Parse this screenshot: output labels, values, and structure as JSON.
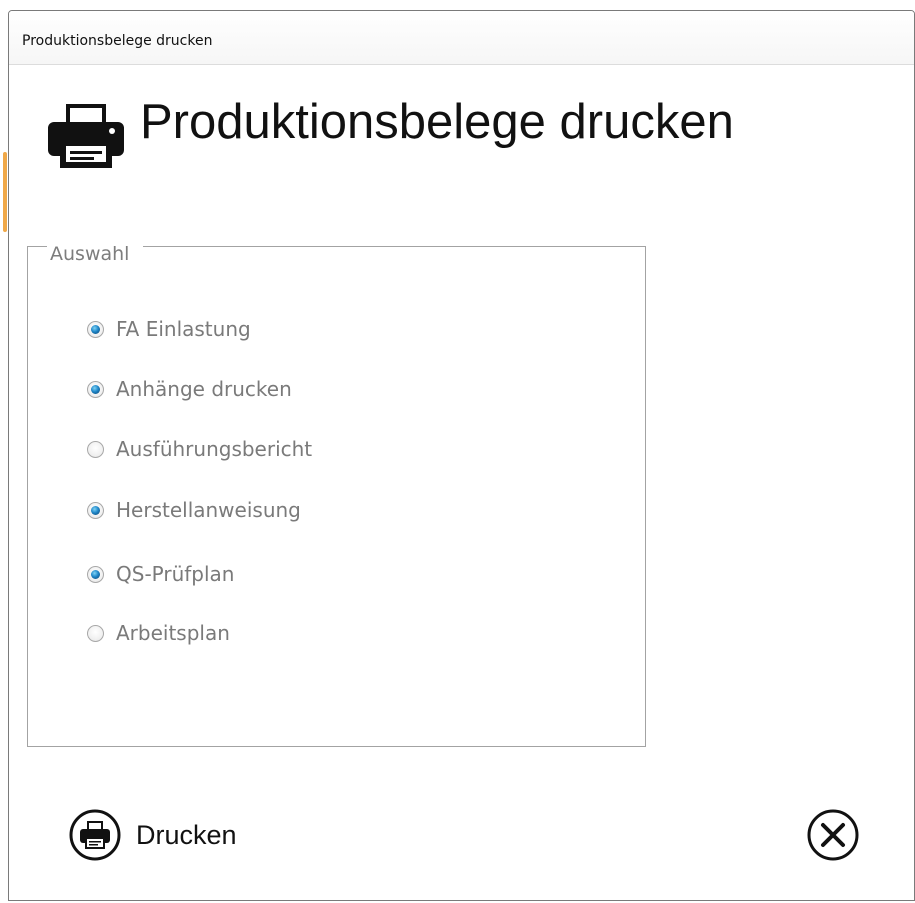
{
  "window": {
    "title": "Produktionsbelege drucken"
  },
  "header": {
    "icon": "printer-icon",
    "title": "Produktionsbelege drucken"
  },
  "selection": {
    "legend": "Auswahl",
    "options": [
      {
        "label": "FA Einlastung",
        "checked": true
      },
      {
        "label": "Anhänge drucken",
        "checked": true
      },
      {
        "label": "Ausführungsbericht",
        "checked": false
      },
      {
        "label": "Herstellanweisung",
        "checked": true
      },
      {
        "label": "QS-Prüfplan",
        "checked": true
      },
      {
        "label": "Arbeitsplan",
        "checked": false
      }
    ]
  },
  "footer": {
    "print_label": "Drucken",
    "print_icon": "printer-circle-icon",
    "close_icon": "close-circle-icon"
  },
  "colors": {
    "accent": "#f0a848",
    "radio_checked": "#1f87c9",
    "label_disabled": "#7a7a7a"
  }
}
